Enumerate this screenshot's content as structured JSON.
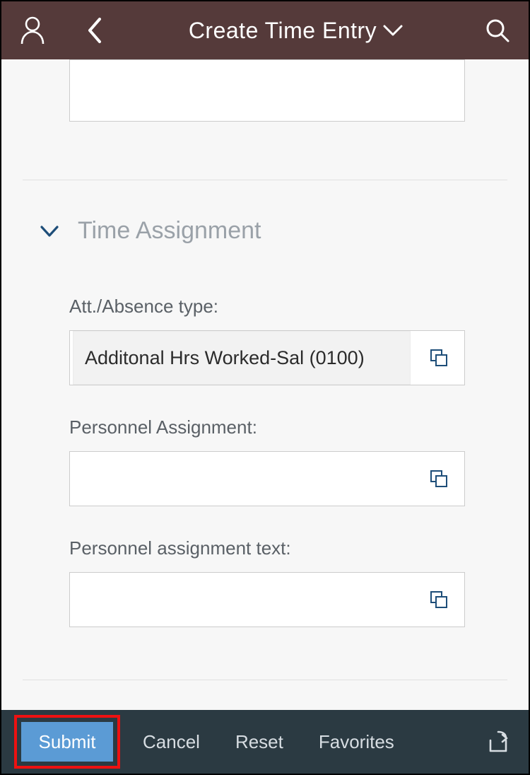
{
  "header": {
    "title": "Create Time Entry"
  },
  "sections": {
    "time_assignment": {
      "title": "Time Assignment",
      "fields": {
        "att_absence_type": {
          "label": "Att./Absence type:",
          "value": "Additonal Hrs Worked-Sal (0100)"
        },
        "personnel_assignment": {
          "label": "Personnel Assignment:",
          "value": ""
        },
        "personnel_assignment_text": {
          "label": "Personnel assignment text:",
          "value": ""
        }
      }
    }
  },
  "footer": {
    "submit": "Submit",
    "cancel": "Cancel",
    "reset": "Reset",
    "favorites": "Favorites"
  }
}
